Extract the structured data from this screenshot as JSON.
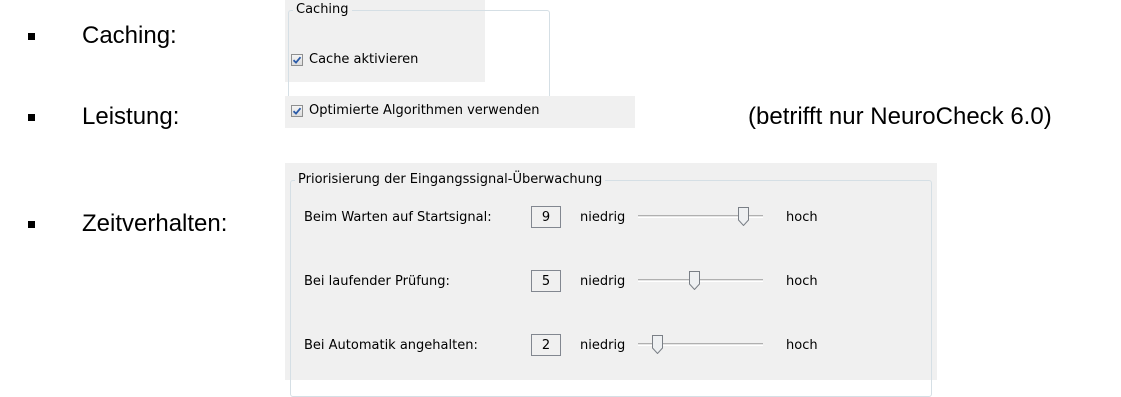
{
  "bullets": [
    {
      "label": "Caching:"
    },
    {
      "label": "Leistung:"
    },
    {
      "label": "Zeitverhalten:"
    }
  ],
  "note": "(betrifft nur NeuroCheck 6.0)",
  "caching_panel": {
    "group_title": "Caching",
    "checkbox_label": "Cache aktivieren",
    "checked": true
  },
  "leistung_panel": {
    "checkbox_label": "Optimierte Algorithmen verwenden",
    "checked": true
  },
  "zeit_panel": {
    "group_title": "Priorisierung der Eingangssignal-Überwachung",
    "low_label": "niedrig",
    "high_label": "hoch",
    "slider_min": 1,
    "slider_max": 10,
    "rows": [
      {
        "label": "Beim Warten auf Startsignal:",
        "value": "9"
      },
      {
        "label": "Bei laufender Prüfung:",
        "value": "5"
      },
      {
        "label": "Bei Automatik angehalten:",
        "value": "2"
      }
    ]
  },
  "colors": {
    "panel_bg": "#f0f0f0",
    "check_blue": "#2a5aa8"
  }
}
